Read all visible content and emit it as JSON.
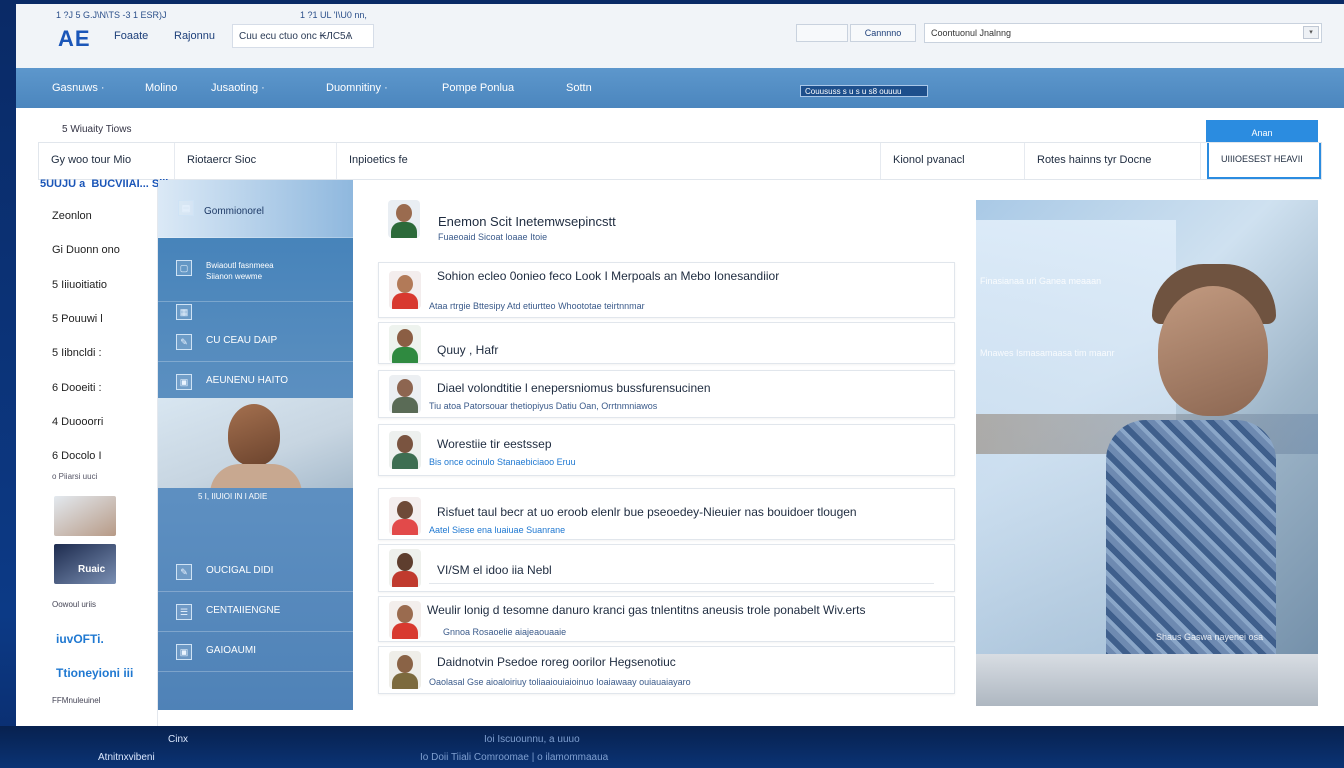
{
  "topbar": {
    "crumb_left": "1 ?J 5 G.J\\N\\TS -3 1  ESR)J",
    "crumb_mid": "1 ?1 UL  'I\\U0 nn,",
    "logo": "AE",
    "links": [
      "Foaate",
      "Rajonnu"
    ],
    "search_value": "Cuu ecu ctuo onc  ₭ЛС5Ѧ",
    "btn_blank": "",
    "btn_primary": "Cannnno",
    "url_value": "Coontuonul Jnalnng",
    "dropdown_glyph": "▾"
  },
  "nav": {
    "items": [
      "Gasnuws ·",
      "Molino",
      "Jusaoting ·",
      "Duomnitiny ·",
      "Pompe Ponlua",
      "Sottn"
    ],
    "badge": "Couusus⁣s s u  s u s8 ouuuu"
  },
  "subcrumb": "5 Wiuaity Tiows",
  "corner_label": "Anan",
  "tabs": [
    {
      "label": "Gy woo tour Mio"
    },
    {
      "label": "Riotaercr Sioc"
    },
    {
      "label": "Inpioetics fe"
    },
    {
      "label": "Kionol pvanacl"
    },
    {
      "label": "Rotes hainns tyr Docne"
    },
    {
      "label": "UIIIOESEST HEAVII"
    }
  ],
  "ribbon": "5UUJU a ⁣ BUCVIIAI...  Sliir",
  "left": {
    "items": [
      "Zeonlon",
      "Gi Duonn ono",
      "5 Iiiuoitiatio",
      "5 Pouuwi l",
      "5 Iibncldi :",
      "6 Dooeiti :",
      "4 Duooorri",
      "6 Docolo I"
    ],
    "small_note": "o  Piiarsi uuci",
    "thumb_caption": "Ruaic",
    "thumb_note": "Oowoul uriis",
    "blue_a": "iuvOFTi.",
    "blue_b": "Ttioneyioni iii",
    "bottom_note": "FFMnuleuinel"
  },
  "panel": {
    "head": "Gommionorel",
    "sub": "Bwiaoutl fasnmeea Siianon wewme",
    "rows": [
      "CU CEAU DAIP",
      "AEUNENU HAITO"
    ],
    "photo_caption": "5 I, IIUIOI IN I ADIE",
    "rows_bottom": [
      "OUCIGAL DIDI",
      "CENTAIIENGNE",
      "GAIOAUMI"
    ]
  },
  "feed": [
    {
      "title": "Enemon Scit Inetemwsepincstt",
      "sub": "Fuaeoaid Sicoat loaae Itoie"
    },
    {
      "title": "Sohion ecleo 0onieo feco Look I Merpoals an Mebo Ionesandiior",
      "sub": "Ataa rtrgie Bttesipy Atd etiurtteo Whoototae teirtnnmar"
    },
    {
      "title": "Quuy , Hafr",
      "sub": ""
    },
    {
      "title": "Diael volondtitie l enepersniomus bussfurensucinen",
      "sub": "Tiu atoa Patorsouar thetiopiyus Datiu Oan, Orrtnmniawos"
    },
    {
      "title": "Worestiie tir eestssep",
      "sub": "Bis once ocinulo  Stanaebiciaoo Eruu"
    },
    {
      "title": "Risfuet taul becr at uo eroob elenlr bue pseoedey-Nieuier nas bouidoer tlougen",
      "sub": "Aatel Siese ena luaiuae Suanrane"
    },
    {
      "title": "VI/SM el idoo iia Nebl",
      "sub": ""
    },
    {
      "title": "Weulir lonig d tesomne danuro kranci gas tnlentitns aneusis trole ponabelt Wiv.erts",
      "sub": "Gnnoa  Rosaoelie aiajeaouaaie"
    },
    {
      "title": "Daidnotvin Psedoe roreg oorilor Hegsenotiuc",
      "sub": "Oaolasal Gse aioaloiriuy toliaaiouiaioinuo Ioaiawaay ouiauaiayaro"
    }
  ],
  "hero": {
    "overlay_a": "Finasianaa uri Ganea meaaan",
    "overlay_b": "Mnawes Ismasamaasa tim maanr",
    "overlay_c": "Shaus Gaswa nayenei osa"
  },
  "taskbar": {
    "item_a": "Atnitnxvibeni",
    "item_b": "Cinx",
    "item_c": "Ioi  Iscuounnu, a  uuuo",
    "item_d": "Io  Doii Tiiali  Comroomae  | o ilamommaaua"
  }
}
